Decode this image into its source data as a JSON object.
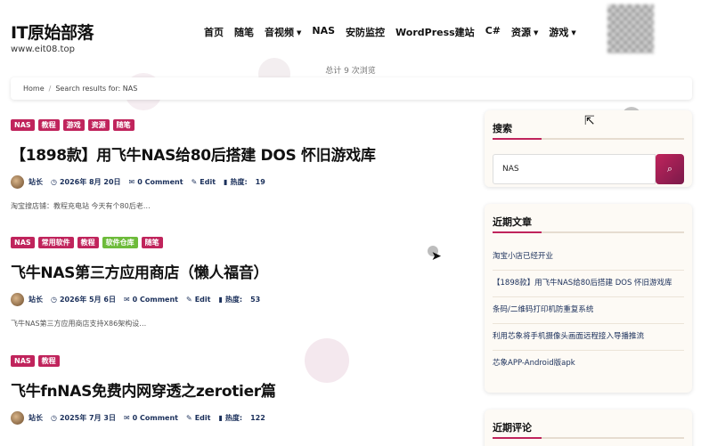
{
  "site": {
    "title": "IT原始部落",
    "url": "www.eit08.top"
  },
  "nav": [
    {
      "label": "首页",
      "caret": ""
    },
    {
      "label": "随笔",
      "caret": ""
    },
    {
      "label": "音视频",
      "caret": "▼"
    },
    {
      "label": "NAS",
      "caret": ""
    },
    {
      "label": "安防监控",
      "caret": ""
    },
    {
      "label": "WordPress建站",
      "caret": ""
    },
    {
      "label": "C#",
      "caret": ""
    },
    {
      "label": "资源",
      "caret": "▼"
    },
    {
      "label": "游戏",
      "caret": "▼"
    }
  ],
  "view_count": "总计 9 次浏览",
  "breadcrumb": {
    "home": "Home",
    "sep": "/",
    "current": "Search results for: NAS"
  },
  "tag_colors": {
    "primary": "#c0245c",
    "green": "#6dbb3a"
  },
  "posts": [
    {
      "tags": [
        "NAS",
        "教程",
        "游戏",
        "资源",
        "随笔"
      ],
      "title": "【1898款】用飞牛NAS给80后搭建 DOS 怀旧游戏库",
      "author": "站长",
      "date": "2026年 8月 20日",
      "comments": "0 Comment",
      "edit": "Edit",
      "hot_label": "热度:",
      "hot": "19",
      "excerpt": "淘宝搜店铺：教程充电站 今天有个80后老…"
    },
    {
      "tags": [
        "NAS",
        "常用软件",
        "教程",
        "软件仓库",
        "随笔"
      ],
      "title": "飞牛NAS第三方应用商店（懒人福音）",
      "author": "站长",
      "date": "2026年 5月 6日",
      "comments": "0 Comment",
      "edit": "Edit",
      "hot_label": "热度:",
      "hot": "53",
      "excerpt": "飞牛NAS第三方应用商店支持X86架构设…"
    },
    {
      "tags": [
        "NAS",
        "教程"
      ],
      "title": "飞牛fnNAS免费内网穿透之zerotier篇",
      "author": "站长",
      "date": "2025年 7月 3日",
      "comments": "0 Comment",
      "edit": "Edit",
      "hot_label": "热度:",
      "hot": "122",
      "excerpt": ""
    }
  ],
  "sidebar": {
    "search": {
      "title": "搜索",
      "value": "NAS"
    },
    "recent": {
      "title": "近期文章",
      "items": [
        "淘宝小店已经开业",
        "【1898款】用飞牛NAS给80后搭建 DOS 怀旧游戏库",
        "条码/二维码打印机防重复系统",
        "利用芯象将手机摄像头画面远程接入导播推流",
        "芯象APP-Android版apk"
      ]
    },
    "comments": {
      "title": "近期评论"
    }
  }
}
